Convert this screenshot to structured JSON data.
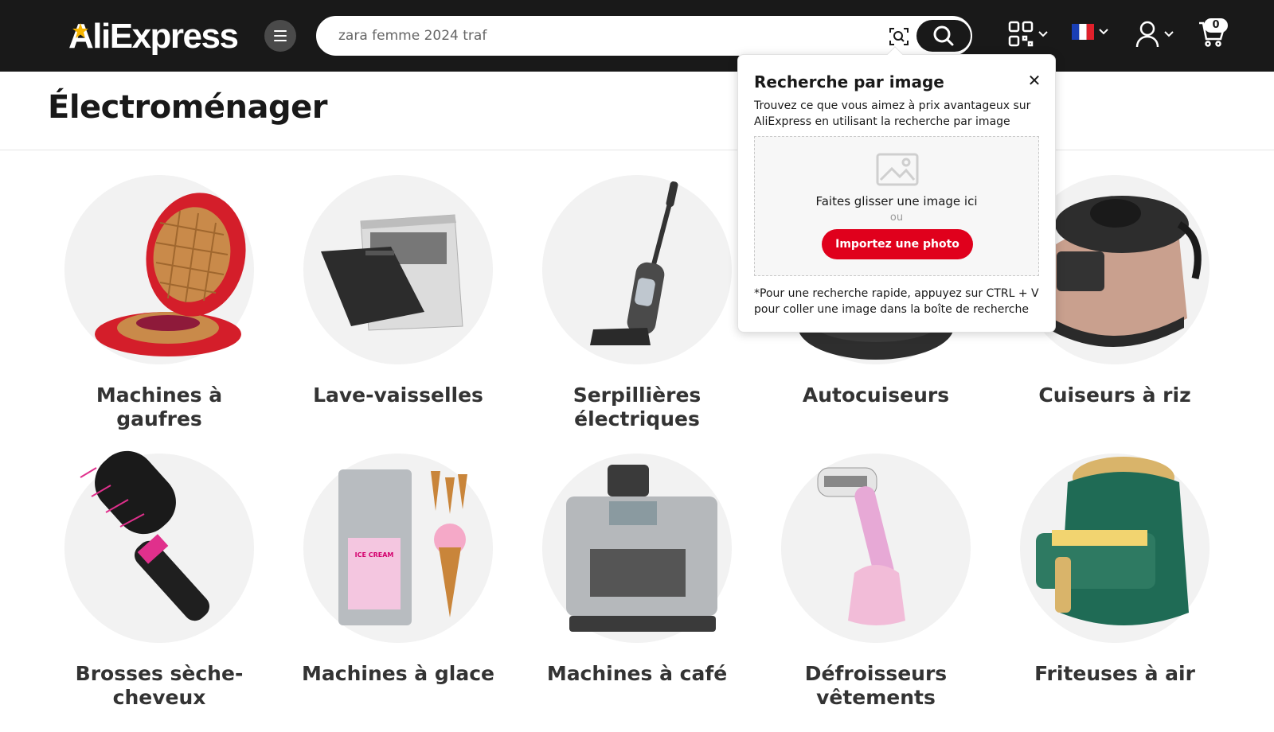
{
  "header": {
    "logo_text": "AliExpress",
    "search_placeholder": "zara femme 2024 traf",
    "cart_count": "0",
    "accent_color": "#e0001c",
    "bar_color": "#191919",
    "icons": [
      "menu-icon",
      "camera-search-icon",
      "search-icon",
      "qr-code-icon",
      "flag-fr-icon",
      "user-icon",
      "cart-icon"
    ]
  },
  "page": {
    "title": "Électroménager"
  },
  "categories": [
    {
      "label": "Machines à gaufres"
    },
    {
      "label": "Lave-vaisselles"
    },
    {
      "label": "Serpillières électriques"
    },
    {
      "label": "Autocuiseurs"
    },
    {
      "label": "Cuiseurs à riz"
    },
    {
      "label": "Brosses sèche-cheveux"
    },
    {
      "label": "Machines à glace"
    },
    {
      "label": "Machines à café"
    },
    {
      "label": "Défroisseurs vêtements"
    },
    {
      "label": "Friteuses à air"
    }
  ],
  "image_search_popup": {
    "title": "Recherche par image",
    "description": "Trouvez ce que vous aimez à prix avantageux sur AliExpress en utilisant la recherche par image",
    "drag_text": "Faites glisser une image ici",
    "or_text": "ou",
    "upload_button": "Importez une photo",
    "tip": "*Pour une recherche rapide, appuyez sur CTRL + V pour coller une image dans la boîte de recherche"
  }
}
